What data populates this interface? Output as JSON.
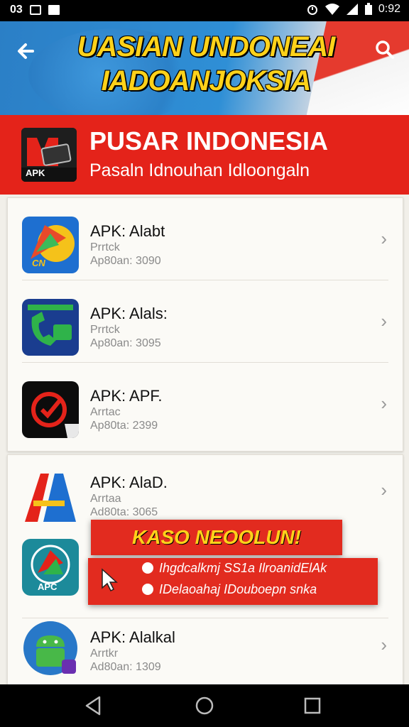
{
  "status_bar": {
    "left_text": "03",
    "time": "0:92"
  },
  "header": {
    "title_line1": "UASIAN UNDONEAI",
    "title_line2": "IADOANJOKSIA"
  },
  "promo": {
    "logo_text": "APK",
    "title": "PUSAR INDONESIA",
    "subtitle": "Pasaln Idnouhan Idloongaln"
  },
  "apps": [
    {
      "name": "APK: Alabt",
      "type": "Prrtck",
      "size": "Ap80an: 3090",
      "icon": "kite-app-icon",
      "icon_text": "CN"
    },
    {
      "name": "APK: Alals:",
      "type": "Prrtck",
      "size": "Ap80an: 3095",
      "icon": "phone-app-icon"
    },
    {
      "name": "APK: APF.",
      "type": "Arrtac",
      "size": "Ap80ta: 2399",
      "icon": "target-app-icon"
    },
    {
      "name": "APK: AlaD.",
      "type": "Arrtaa",
      "size": "Ad80ta: 3065",
      "icon": "letter-a-app-icon"
    },
    {
      "name": "",
      "type": "",
      "size": "",
      "icon": "apc-app-icon",
      "icon_text": "APC"
    },
    {
      "name": "APK: Alalkal",
      "type": "Arrtkr",
      "size": "Ad80an: 1309",
      "icon": "android-app-icon"
    }
  ],
  "overlay": {
    "title": "KASO NEOOLUN!",
    "line1": "Ihgdcalkmj SS1a IlroanidElAk",
    "line2": "IDelaoahaj IDouboepn snka"
  },
  "colors": {
    "accent": "#e4231a",
    "header_blue": "#2b7fc6",
    "title_yellow": "#ffd21a"
  }
}
